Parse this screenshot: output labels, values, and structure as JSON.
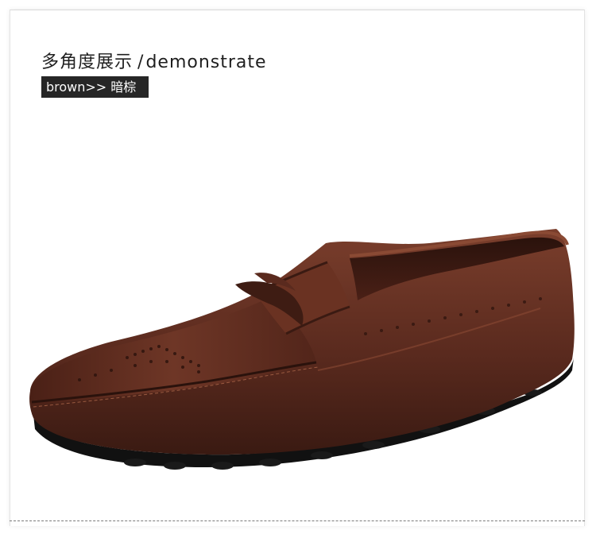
{
  "header": {
    "title_cn": "多角度展示",
    "title_sep": "/",
    "title_en": "demonstrate"
  },
  "color_tag": {
    "label": "brown>> 暗棕"
  },
  "product": {
    "image_icon": "brown-leather-loafer-icon",
    "colors": {
      "leather_dark": "#3a1a12",
      "leather_mid": "#5a2a1e",
      "leather_light": "#7a3e2c",
      "sole": "#111111"
    }
  }
}
